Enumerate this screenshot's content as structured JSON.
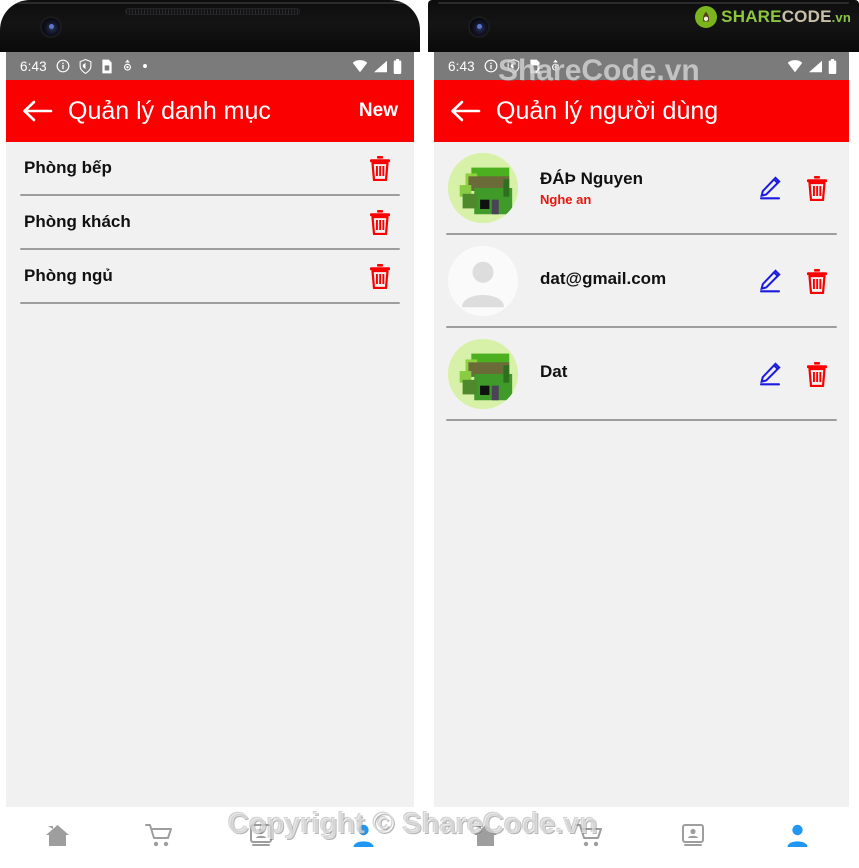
{
  "watermarks": {
    "top": "ShareCode.vn",
    "bottom": "Copyright © ShareCode.vn"
  },
  "logo": {
    "share": "SHARE",
    "code": "CODE",
    "vn": ".vn",
    "mark_icon": "sharecode-leaf-icon"
  },
  "phones": [
    {
      "id": "left",
      "status_bar": {
        "time": "6:43",
        "left_icons": [
          "info-icon",
          "shield-icon",
          "sim-card-icon",
          "sync-icon",
          "dot-icon"
        ],
        "right_icons": [
          "wifi-icon",
          "signal-icon",
          "battery-icon"
        ]
      },
      "app_bar": {
        "back_icon": "back-arrow-icon",
        "title": "Quản lý danh mục",
        "action_label": "New",
        "background": "#fa0000"
      },
      "screen_type": "category-list",
      "categories": [
        {
          "name": "Phòng bếp",
          "delete_icon": "trash-icon"
        },
        {
          "name": "Phòng khách",
          "delete_icon": "trash-icon"
        },
        {
          "name": "Phòng ngủ",
          "delete_icon": "trash-icon"
        }
      ],
      "bottom_nav": [
        {
          "icon": "home-icon",
          "active": false
        },
        {
          "icon": "cart-icon",
          "active": false
        },
        {
          "icon": "contact-card-icon",
          "active": false
        },
        {
          "icon": "person-icon",
          "active": true
        }
      ]
    },
    {
      "id": "right",
      "status_bar": {
        "time": "6:43",
        "left_icons": [
          "info-icon",
          "shield-icon",
          "sim-card-icon",
          "sync-icon",
          "dot-icon"
        ],
        "right_icons": [
          "wifi-icon",
          "signal-icon",
          "battery-icon"
        ]
      },
      "app_bar": {
        "back_icon": "back-arrow-icon",
        "title": "Quản lý người dùng",
        "action_label": "",
        "background": "#fa0000"
      },
      "screen_type": "user-list",
      "users": [
        {
          "name": "ĐÁÞ Nguyen",
          "subtitle": "Nghe an",
          "avatar": "house-photo",
          "edit_icon": "pencil-icon",
          "delete_icon": "trash-icon"
        },
        {
          "name": "dat@gmail.com",
          "subtitle": "",
          "avatar": "default-person-avatar",
          "edit_icon": "pencil-icon",
          "delete_icon": "trash-icon"
        },
        {
          "name": "Dat",
          "subtitle": "",
          "avatar": "house-photo",
          "edit_icon": "pencil-icon",
          "delete_icon": "trash-icon"
        }
      ],
      "bottom_nav": [
        {
          "icon": "home-icon",
          "active": false
        },
        {
          "icon": "cart-icon",
          "active": false
        },
        {
          "icon": "contact-card-icon",
          "active": false
        },
        {
          "icon": "person-icon",
          "active": true
        }
      ]
    }
  ],
  "colors": {
    "app_bar": "#fa0000",
    "screen_bg": "#f1f1f1",
    "status_bar": "#7b7b7b",
    "trash": "#fa0000",
    "pencil": "#1a1ae0",
    "subtitle": "#e8160c",
    "nav_active": "#2196f3",
    "nav_inactive": "#9e9e9e"
  }
}
